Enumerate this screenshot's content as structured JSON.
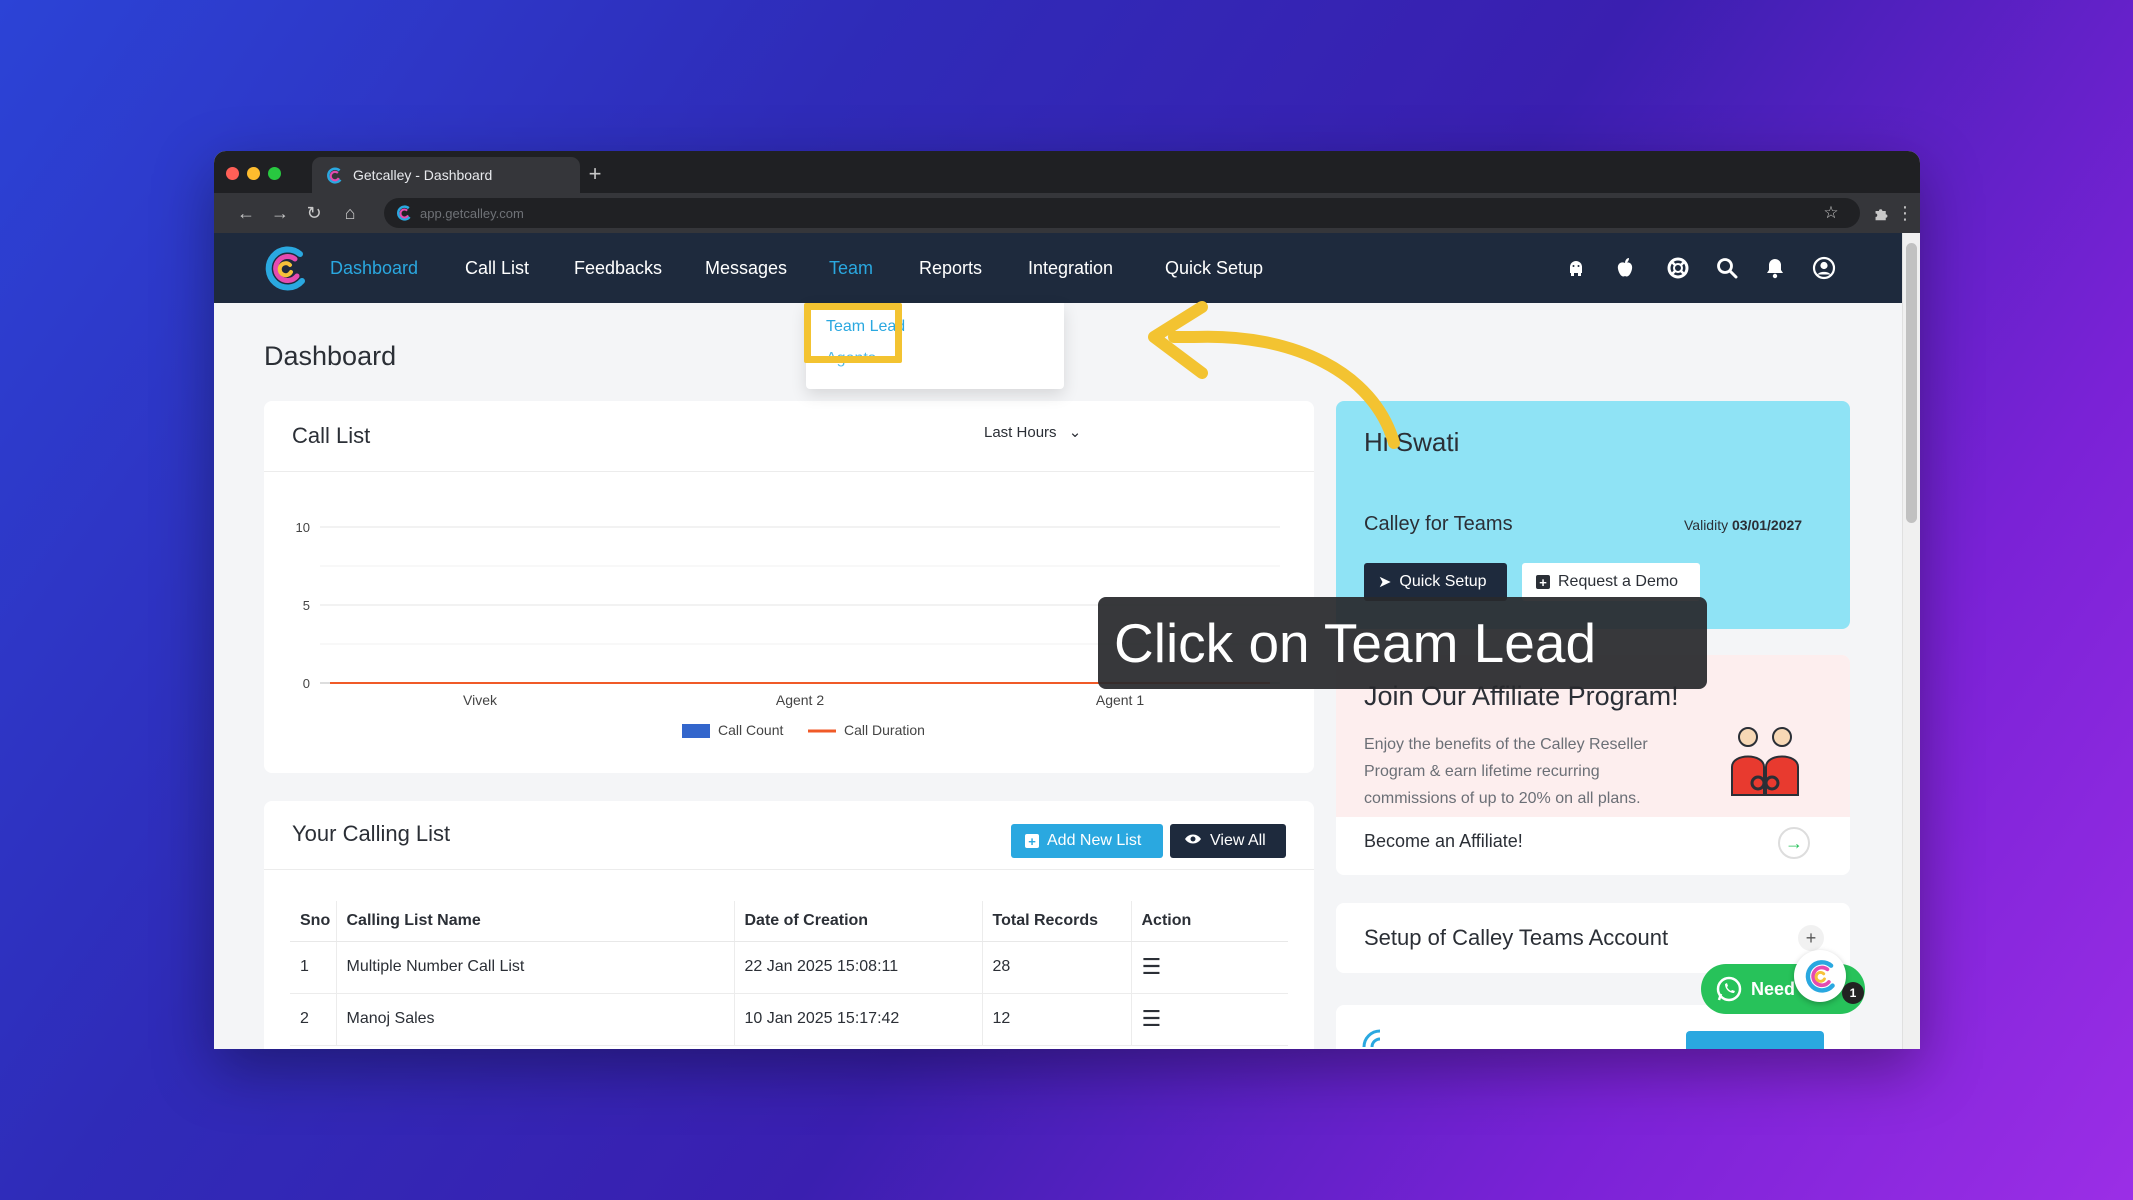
{
  "browser": {
    "tab_title": "Getcalley - Dashboard",
    "url": "app.getcalley.com"
  },
  "nav": {
    "items": [
      "Dashboard",
      "Call List",
      "Feedbacks",
      "Messages",
      "Team",
      "Reports",
      "Integration",
      "Quick Setup"
    ],
    "active": "Dashboard",
    "highlighted": "Team"
  },
  "team_menu": {
    "items": [
      "Team Lead",
      "Agents"
    ]
  },
  "page": {
    "title": "Dashboard"
  },
  "tutorial": {
    "caption": "Click on Team Lead"
  },
  "call_list_card": {
    "title": "Call List",
    "range": "Last Hours"
  },
  "chart_data": {
    "type": "bar",
    "categories": [
      "Vivek",
      "Agent 2",
      "Agent 1"
    ],
    "series": [
      {
        "name": "Call Count",
        "values": [
          0,
          0,
          0
        ],
        "color": "#3366cc"
      },
      {
        "name": "Call Duration",
        "values": [
          0,
          0,
          0
        ],
        "color": "#f05a28"
      }
    ],
    "yticks": [
      "10",
      "5",
      "0"
    ],
    "ylim": [
      0,
      10
    ],
    "legend": "bottom"
  },
  "calling_list": {
    "title": "Your Calling List",
    "add_label": "Add New List",
    "view_label": "View All",
    "columns": [
      "Sno",
      "Calling List Name",
      "Date of Creation",
      "Total Records",
      "Action"
    ],
    "rows": [
      {
        "sno": "1",
        "name": "Multiple Number Call List",
        "date": "22 Jan 2025 15:08:11",
        "records": "28"
      },
      {
        "sno": "2",
        "name": "Manoj Sales",
        "date": "10 Jan 2025 15:17:42",
        "records": "12"
      }
    ]
  },
  "welcome_card": {
    "greeting": "Hi Swati",
    "plan": "Calley for Teams",
    "validity_label": "Validity",
    "validity_date": "03/01/2027",
    "quick_setup_label": "Quick Setup",
    "demo_label": "Request a Demo"
  },
  "affiliate_card": {
    "title": "Join Our Affiliate Program!",
    "body_lines": [
      "Enjoy the benefits of the Calley Reseller",
      "Program & earn lifetime recurring",
      "commissions of up to 20% on all plans."
    ],
    "link_label": "Become an Affiliate!"
  },
  "setup_card": {
    "title": "Setup of Calley Teams Account"
  },
  "chat": {
    "label": "Need",
    "badge": "1"
  },
  "colors": {
    "nav_bg": "#1e2a3d",
    "accent": "#2aa8e0",
    "highlight": "#f3c331",
    "welcome_bg": "#8fe3f5",
    "affiliate_bg": "#fdeeee"
  }
}
